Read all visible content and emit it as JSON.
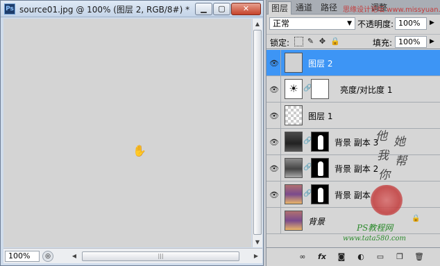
{
  "document": {
    "app_icon_label": "Ps",
    "title": "source01.jpg @ 100% (图层 2, RGB/8#) *",
    "minimize_label": "▁",
    "maximize_label": "▢",
    "close_label": "✕",
    "zoom_value": "100%",
    "canvas_color": "#d4d4d4"
  },
  "panel": {
    "tabs": [
      "图层",
      "通道",
      "路径",
      "调整"
    ],
    "watermark_top": "思缘设计论坛 www.missyuan.com",
    "blend_mode": "正常",
    "opacity_label": "不透明度:",
    "opacity_value": "100%",
    "lock_label": "锁定:",
    "fill_label": "填充:",
    "fill_value": "100%",
    "layers": [
      {
        "name": "图层 2",
        "visible": true,
        "selected": true
      },
      {
        "name": "亮度/对比度 1",
        "visible": true,
        "selected": false
      },
      {
        "name": "图层 1",
        "visible": true,
        "selected": false
      },
      {
        "name": "背景 副本 3",
        "visible": true,
        "selected": false
      },
      {
        "name": "背景 副本 2",
        "visible": true,
        "selected": false
      },
      {
        "name": "背景 副本",
        "visible": true,
        "selected": false
      },
      {
        "name": "背景",
        "visible": false,
        "selected": false,
        "locked": true
      }
    ],
    "calligraphy": [
      "他",
      "她",
      "我",
      "帮",
      "你"
    ],
    "watermark_brand": "PS教程网",
    "watermark_url": "www.tata580.com"
  },
  "colors": {
    "selection": "#3d95f5",
    "title_close": "#c5432b",
    "watermark_green": "#2d8a2d",
    "seal_red": "#c23b3b"
  }
}
